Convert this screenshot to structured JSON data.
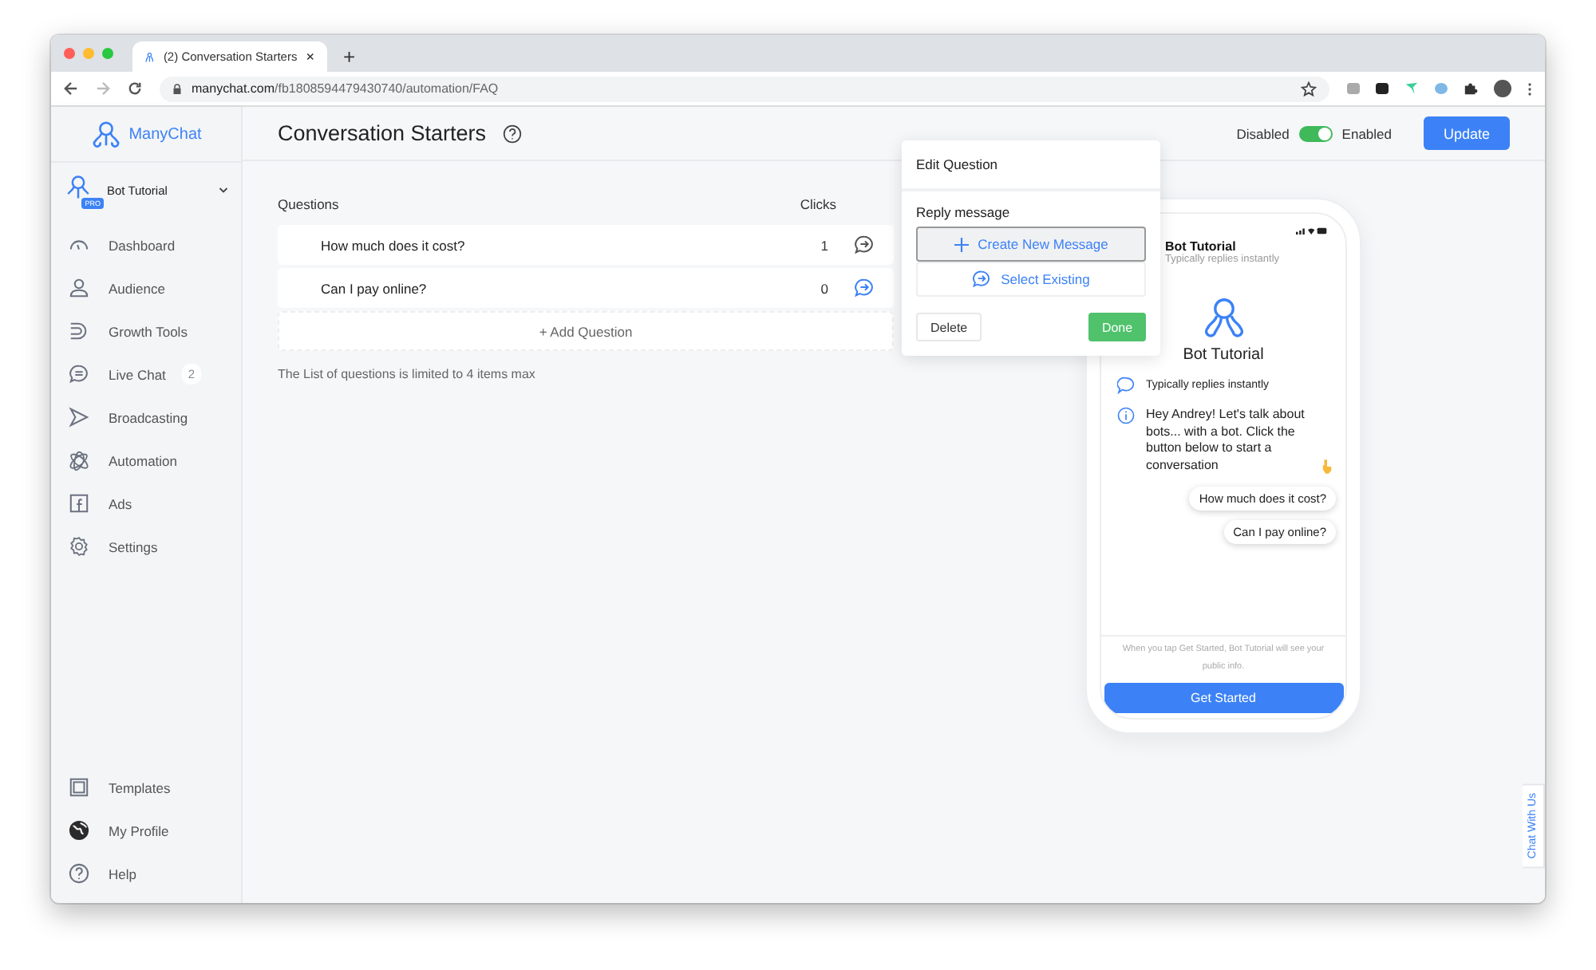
{
  "browser": {
    "tab_title": "(2) Conversation Starters",
    "new_tab": "+",
    "url_host": "manychat.com",
    "url_path": "/fb1808594479430740/automation/FAQ"
  },
  "sidebar": {
    "brand": "ManyChat",
    "account": {
      "name": "Bot Tutorial",
      "badge": "PRO"
    },
    "items": [
      {
        "kind": "dashboard",
        "label": "Dashboard"
      },
      {
        "kind": "audience",
        "label": "Audience"
      },
      {
        "kind": "growth",
        "label": "Growth Tools"
      },
      {
        "kind": "chat",
        "label": "Live Chat",
        "badge": "2"
      },
      {
        "kind": "broadcast",
        "label": "Broadcasting"
      },
      {
        "kind": "automation",
        "label": "Automation"
      },
      {
        "kind": "ads",
        "label": "Ads"
      },
      {
        "kind": "settings",
        "label": "Settings"
      }
    ],
    "bottom_items": [
      {
        "kind": "templates",
        "label": "Templates"
      },
      {
        "kind": "profile",
        "label": "My Profile"
      },
      {
        "kind": "help",
        "label": "Help"
      }
    ]
  },
  "header": {
    "title": "Conversation Starters",
    "toggle": {
      "off_label": "Disabled",
      "on_label": "Enabled",
      "on": true
    },
    "update_button": "Update"
  },
  "questions": {
    "columns": [
      "Questions",
      "Clicks"
    ],
    "rows": [
      {
        "text": "How much does it cost?",
        "clicks": "1",
        "reply_set": false
      },
      {
        "text": "Can I pay online?",
        "clicks": "0",
        "reply_set": true
      }
    ],
    "add_button": "+ Add Question",
    "note": "The List of questions is limited to 4 items max"
  },
  "popover": {
    "title": "Edit Question",
    "section": "Reply message",
    "create_button": "Create New Message",
    "select_button": "Select Existing",
    "delete_button": "Delete",
    "done_button": "Done"
  },
  "phone": {
    "header_name": "Bot Tutorial",
    "header_status": "Typically replies instantly",
    "bot_name": "Bot Tutorial",
    "status_line": "Typically replies instantly",
    "greeting": "Hey Andrey! Let's talk about bots... with a bot. Click the button below to start a conversation",
    "quick_replies": [
      "How much does it cost?",
      "Can I pay online?"
    ],
    "disclaimer": "When you tap Get Started, Bot Tutorial will see your public info.",
    "start_button": "Get Started"
  },
  "chat_widget": "Chat With Us"
}
